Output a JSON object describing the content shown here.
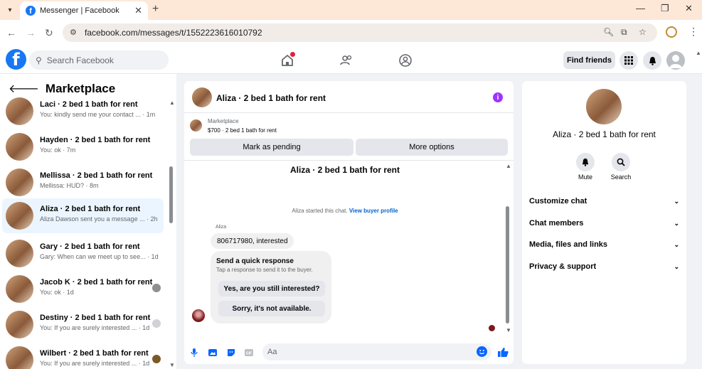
{
  "browser": {
    "tab_title": "Messenger | Facebook",
    "url": "facebook.com/messages/t/1552223616010792"
  },
  "header": {
    "search_placeholder": "Search Facebook",
    "find_friends": "Find friends"
  },
  "sidebar": {
    "title": "Marketplace",
    "conversations": [
      {
        "name": "Laci · 2 bed 1 bath for rent",
        "snippet": "You: kindly send me your contact ... · 1m",
        "active": false
      },
      {
        "name": "Hayden · 2 bed 1 bath for rent",
        "snippet": "You: ok · 7m",
        "active": false
      },
      {
        "name": "Mellissa · 2 bed 1 bath for rent",
        "snippet": "Mellissa: HUD? · 8m",
        "active": false
      },
      {
        "name": "Aliza · 2 bed 1 bath for rent",
        "snippet": "Aliza Dawson sent you a message ... · 2h",
        "active": true
      },
      {
        "name": "Gary · 2 bed 1 bath for rent",
        "snippet": "Gary: When can we meet up to see... · 1d",
        "active": false
      },
      {
        "name": "Jacob K · 2 bed 1 bath for rent",
        "snippet": "You: ok · 1d",
        "active": false
      },
      {
        "name": "Destiny · 2 bed 1 bath for rent",
        "snippet": "You: If you are surely interested ... · 1d",
        "active": false
      },
      {
        "name": "Wilbert · 2 bed 1 bath for rent",
        "snippet": "You: If you are surely interested ... · 1d",
        "active": false
      }
    ]
  },
  "conversation": {
    "title": "Aliza · 2 bed 1 bath for rent",
    "marketplace_label": "Marketplace",
    "listing": "$700 · 2 bed 1 bath for rent",
    "mark_pending": "Mark as pending",
    "more_options": "More options",
    "chat_heading": "Aliza · 2 bed 1 bath for rent",
    "started_text": "Aliza started this chat.",
    "view_profile": "View buyer profile",
    "sender_name": "Aliza",
    "message": "806717980, interested",
    "quick_title": "Send a quick response",
    "quick_sub": "Tap a response to send it to the buyer.",
    "quick_1": "Yes, are you still interested?",
    "quick_2": "Sorry, it's not available.",
    "composer_placeholder": "Aa"
  },
  "details": {
    "name": "Aliza · 2 bed 1 bath for rent",
    "mute": "Mute",
    "search": "Search",
    "sections": [
      "Customize chat",
      "Chat members",
      "Media, files and links",
      "Privacy & support"
    ]
  },
  "colors": {
    "brand": "#1877f2",
    "messenger_blue": "#0866ff",
    "info_purple": "#a033ff",
    "notif_red": "#e41e3f"
  }
}
